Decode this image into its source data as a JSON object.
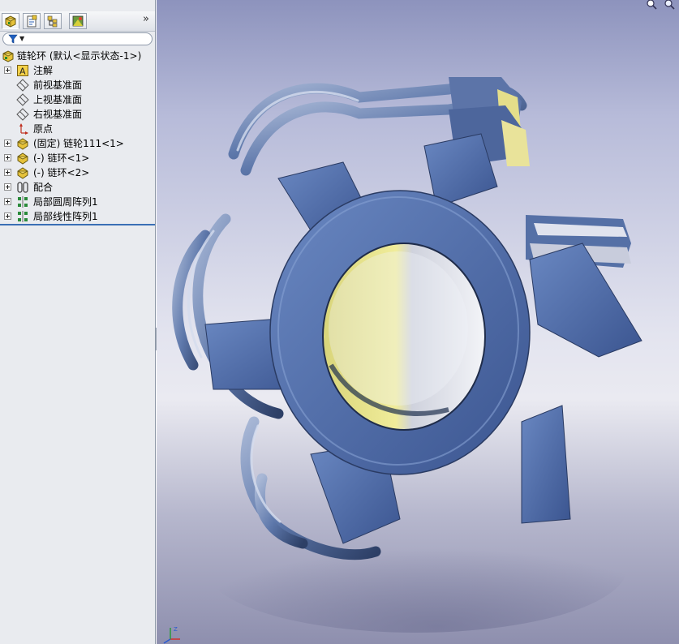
{
  "panel": {
    "tabs": [
      {
        "icon": "feature-manager-icon",
        "active": true
      },
      {
        "icon": "property-manager-icon",
        "active": false
      },
      {
        "icon": "configuration-manager-icon",
        "active": false
      },
      {
        "icon": "display-manager-icon",
        "active": false
      }
    ],
    "collapse_arrow": "»",
    "filter_icon": "filter-icon",
    "tree": {
      "root": "链轮环  (默认<显示状态-1>)",
      "items": [
        {
          "label": "注解",
          "icon": "annotations-icon",
          "expandable": true
        },
        {
          "label": "前视基准面",
          "icon": "plane-icon",
          "expandable": false
        },
        {
          "label": "上视基准面",
          "icon": "plane-icon",
          "expandable": false
        },
        {
          "label": "右视基准面",
          "icon": "plane-icon",
          "expandable": false
        },
        {
          "label": "原点",
          "icon": "origin-icon",
          "expandable": false
        },
        {
          "label": "(固定) 链轮111<1>",
          "icon": "part-icon",
          "expandable": true
        },
        {
          "label": "(-) 链环<1>",
          "icon": "part-icon",
          "expandable": true
        },
        {
          "label": "(-) 链环<2>",
          "icon": "part-icon",
          "expandable": true
        },
        {
          "label": "配合",
          "icon": "mates-icon",
          "expandable": true
        },
        {
          "label": "局部圆周阵列1",
          "icon": "pattern-icon",
          "expandable": true
        },
        {
          "label": "局部线性阵列1",
          "icon": "pattern-icon",
          "expandable": true
        }
      ]
    }
  },
  "view_toolbar": {
    "icons": [
      "zoom-to-fit-icon",
      "zoom-area-icon",
      "previous-view-icon",
      "section-view-icon",
      "view-orientation-icon",
      "display-style-icon",
      "hide-show-items-icon",
      "apply-scene-icon"
    ]
  },
  "colors": {
    "part_blue": "#4a6cae",
    "chain_steel": "#6f8ab8",
    "yellow_face": "#e6e08a",
    "bg_top": "#8d93bd",
    "bg_mid": "#e3e4ef",
    "tree_divider": "#3a6fb5"
  }
}
